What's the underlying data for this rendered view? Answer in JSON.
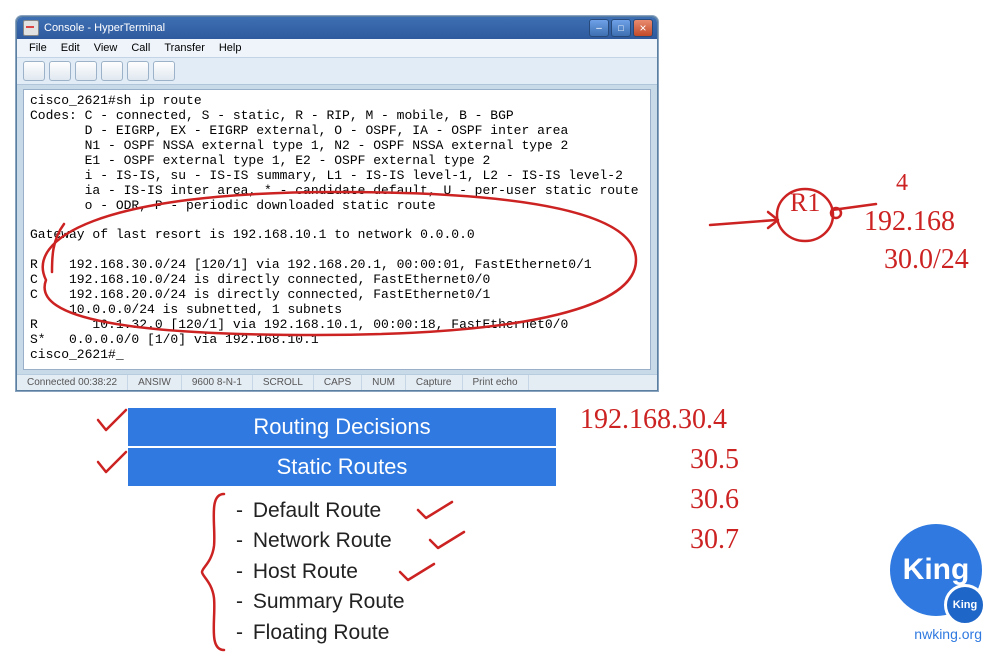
{
  "hyperterminal": {
    "title": "Console - HyperTerminal",
    "menu": [
      "File",
      "Edit",
      "View",
      "Call",
      "Transfer",
      "Help"
    ],
    "status": {
      "connected": "Connected 00:38:22",
      "emulation": "ANSIW",
      "settings": "9600 8-N-1",
      "cells": [
        "SCROLL",
        "CAPS",
        "NUM",
        "Capture",
        "Print echo"
      ]
    },
    "terminal_lines": [
      "cisco_2621#sh ip route",
      "Codes: C - connected, S - static, R - RIP, M - mobile, B - BGP",
      "       D - EIGRP, EX - EIGRP external, O - OSPF, IA - OSPF inter area",
      "       N1 - OSPF NSSA external type 1, N2 - OSPF NSSA external type 2",
      "       E1 - OSPF external type 1, E2 - OSPF external type 2",
      "       i - IS-IS, su - IS-IS summary, L1 - IS-IS level-1, L2 - IS-IS level-2",
      "       ia - IS-IS inter area, * - candidate default, U - per-user static route",
      "       o - ODR, P - periodic downloaded static route",
      "",
      "Gateway of last resort is 192.168.10.1 to network 0.0.0.0",
      "",
      "R    192.168.30.0/24 [120/1] via 192.168.20.1, 00:00:01, FastEthernet0/1",
      "C    192.168.10.0/24 is directly connected, FastEthernet0/0",
      "C    192.168.20.0/24 is directly connected, FastEthernet0/1",
      "     10.0.0.0/24 is subnetted, 1 subnets",
      "R       10.1.32.0 [120/1] via 192.168.10.1, 00:00:18, FastEthernet0/0",
      "S*   0.0.0.0/0 [1/0] via 192.168.10.1",
      "cisco_2621#_"
    ]
  },
  "headings": {
    "bar1": "Routing Decisions",
    "bar2": "Static Routes"
  },
  "bullets": [
    "Default Route",
    "Network Route",
    "Host Route",
    "Summary Route",
    "Floating Route"
  ],
  "annotations": {
    "top_label": "R1",
    "top_num": "4",
    "top_ip1": "192.168",
    "top_ip2": "30.0/24",
    "right_ips": [
      "192.168.30.4",
      "30.5",
      "30.6",
      "30.7"
    ]
  },
  "logo": {
    "text": "King",
    "mini": "King",
    "url": "nwking.org"
  }
}
